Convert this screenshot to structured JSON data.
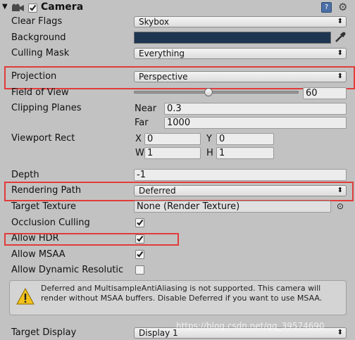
{
  "header": {
    "title": "Camera",
    "enabled": true
  },
  "rows": {
    "clear_flags": {
      "label": "Clear Flags",
      "value": "Skybox"
    },
    "background": {
      "label": "Background",
      "color": "#1e3552"
    },
    "culling_mask": {
      "label": "Culling Mask",
      "value": "Everything"
    },
    "projection": {
      "label": "Projection",
      "value": "Perspective"
    },
    "field_of_view": {
      "label": "Field of View",
      "value": "60",
      "slider_fraction": 0.45
    },
    "clipping_planes": {
      "label": "Clipping Planes",
      "near_label": "Near",
      "near": "0.3",
      "far_label": "Far",
      "far": "1000"
    },
    "viewport_rect": {
      "label": "Viewport Rect",
      "x_label": "X",
      "x": "0",
      "y_label": "Y",
      "y": "0",
      "w_label": "W",
      "w": "1",
      "h_label": "H",
      "h": "1"
    },
    "depth": {
      "label": "Depth",
      "value": "-1"
    },
    "rendering_path": {
      "label": "Rendering Path",
      "value": "Deferred"
    },
    "target_texture": {
      "label": "Target Texture",
      "value": "None (Render Texture)"
    },
    "occlusion_culling": {
      "label": "Occlusion Culling",
      "checked": true
    },
    "allow_hdr": {
      "label": "Allow HDR",
      "checked": true
    },
    "allow_msaa": {
      "label": "Allow MSAA",
      "checked": true
    },
    "allow_dynamic_resolution": {
      "label": "Allow Dynamic Resolutic",
      "checked": false
    },
    "target_display": {
      "label": "Target Display",
      "value": "Display 1"
    }
  },
  "warning": {
    "text": "Deferred and MultisampleAntiAliasing is not supported. This camera will render without MSAA buffers. Disable Deferred if you want to use MSAA."
  },
  "watermark": "https://blog.csdn.net/qq_39574690",
  "colors": {
    "highlight": "#e23b3b",
    "panel": "#c2c2c2"
  }
}
